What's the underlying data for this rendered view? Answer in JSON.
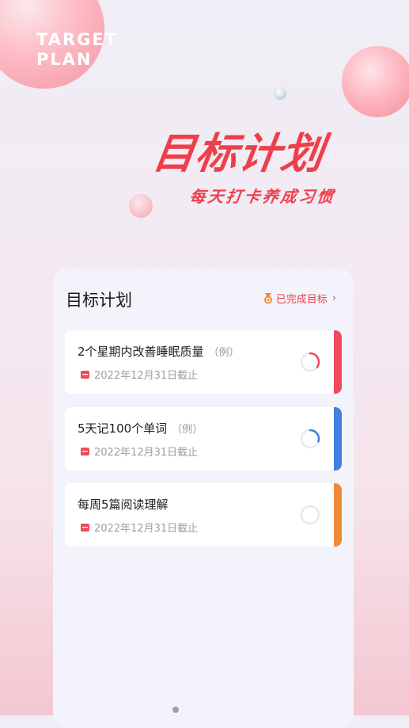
{
  "brand": {
    "line1": "TARGET",
    "line2": "PLAN"
  },
  "hero": {
    "title": "目标计划",
    "subtitle": "每天打卡养成习惯"
  },
  "card": {
    "title": "目标计划",
    "completed_link": "已完成目标",
    "goals": [
      {
        "title": "2个星期内改善睡眠质量",
        "example_tag": "（例）",
        "deadline": "2022年12月31日截止",
        "progress": 0.35,
        "ring_color": "#ef4b5a",
        "accent_color": "#ef4b5a"
      },
      {
        "title": "5天记100个单词",
        "example_tag": "（例）",
        "deadline": "2022年12月31日截止",
        "progress": 0.3,
        "ring_color": "#3f7fe0",
        "accent_color": "#3f7fe0"
      },
      {
        "title": "每周5篇阅读理解",
        "example_tag": "",
        "deadline": "2022年12月31日截止",
        "progress": 0,
        "ring_color": "#f08a3a",
        "accent_color": "#f08a3a"
      }
    ]
  },
  "colors": {
    "accent_red": "#ee3f4a",
    "card_bg": "#f3f3fb"
  }
}
